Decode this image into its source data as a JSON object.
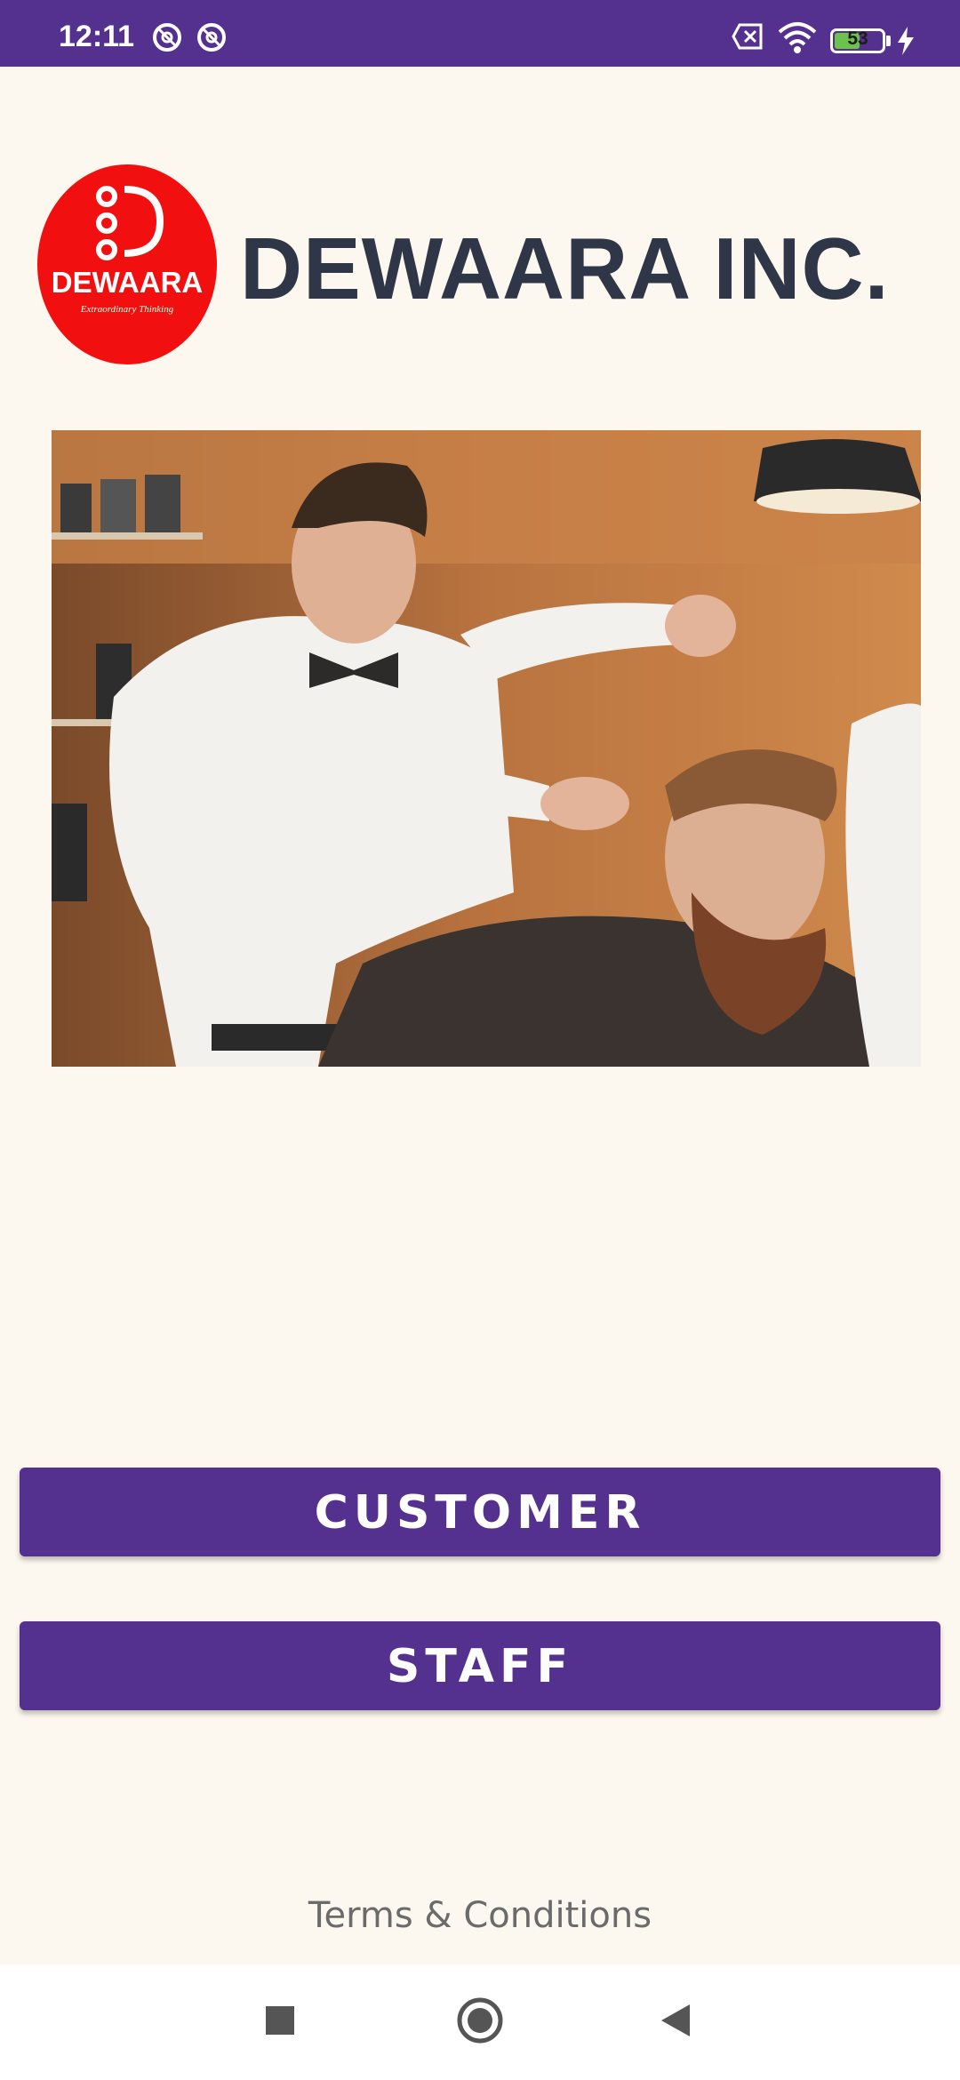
{
  "status_bar": {
    "time": "12:11",
    "battery_level": "53",
    "battery_fraction": 0.53,
    "icons": [
      "do-not-disturb-icon",
      "do-not-disturb-icon",
      "sim-off-icon",
      "wifi-icon",
      "battery-icon",
      "charging-icon"
    ]
  },
  "logo": {
    "mark_text": "DEWAARA",
    "tagline": "Extraordinary Thinking",
    "brand_name": "DEWAARA INC.",
    "circle_color": "#f20f0f"
  },
  "hero": {
    "description_icon": "barber-shop-photo"
  },
  "buttons": {
    "customer_label": "CUSTOMER",
    "staff_label": "STAFF"
  },
  "footer": {
    "terms_label": "Terms & Conditions"
  },
  "colors": {
    "primary": "#54308f",
    "background": "#fdf8ef",
    "brand_text": "#2e3648"
  }
}
